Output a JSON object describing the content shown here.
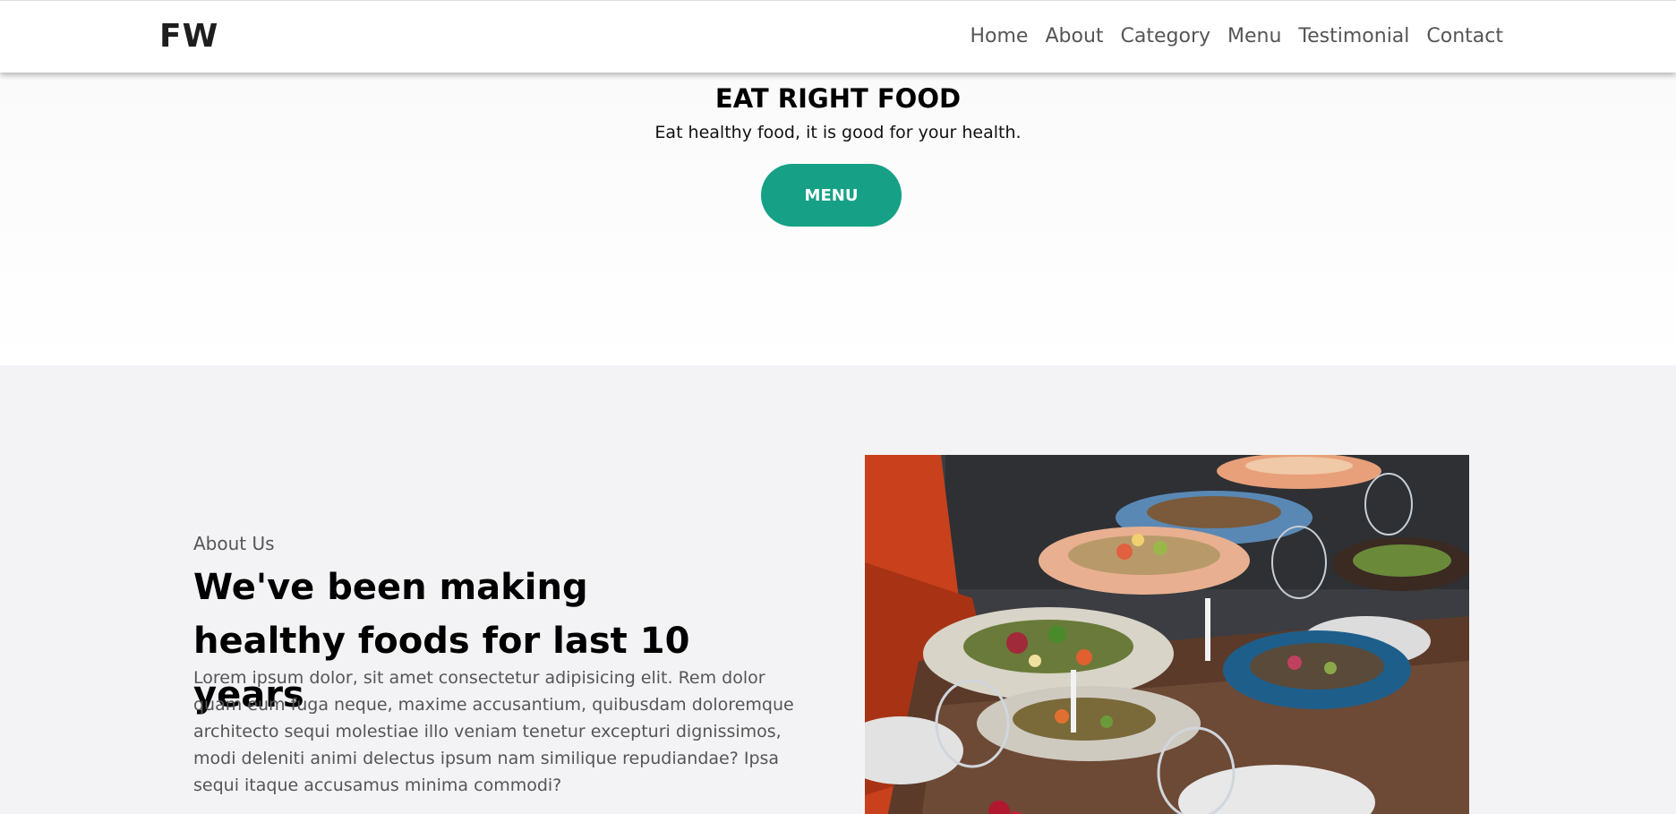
{
  "brand": {
    "logo": "FW"
  },
  "nav": {
    "items": [
      "Home",
      "About",
      "Category",
      "Menu",
      "Testimonial",
      "Contact"
    ]
  },
  "hero": {
    "title": "EAT RIGHT FOOD",
    "subtitle": "Eat healthy food, it is good for your health.",
    "button_label": "MENU"
  },
  "about": {
    "eyebrow": "About Us",
    "heading": "We've been making healthy foods for last 10 years",
    "body": "Lorem ipsum dolor, sit amet consectetur adipisicing elit. Rem dolor quam eum fuga neque, maxime accusantium, quibusdam doloremque architecto sequi molestiae illo veniam tenetur excepturi dignissimos, modi deleniti animi delectus ipsum nam similique repudiandae? Ipsa sequi itaque accusamus minima commodi?"
  },
  "colors": {
    "accent": "#16a085",
    "about_bg": "#f3f3f6"
  }
}
